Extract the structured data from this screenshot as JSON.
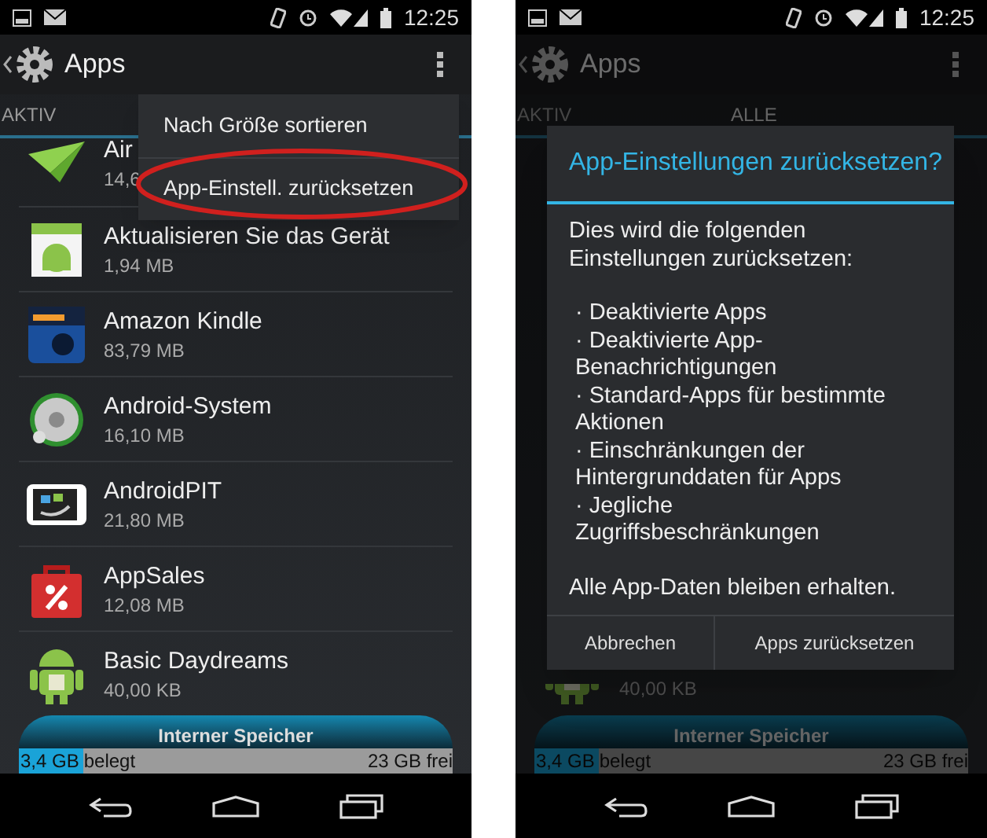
{
  "screens": [
    {
      "status_bar": {
        "time": "12:25"
      },
      "action_bar": {
        "title": "Apps"
      },
      "tabs": [
        {
          "label": "AKTIV",
          "selected": false
        }
      ],
      "apps": [
        {
          "name": "Air",
          "size": "14,6"
        },
        {
          "name": "Aktualisieren Sie das Gerät",
          "size": "1,94 MB"
        },
        {
          "name": "Amazon Kindle",
          "size": "83,79 MB"
        },
        {
          "name": "Android-System",
          "size": "16,10 MB"
        },
        {
          "name": "AndroidPIT",
          "size": "21,80 MB"
        },
        {
          "name": "AppSales",
          "size": "12,08 MB"
        },
        {
          "name": "Basic Daydreams",
          "size": "40,00 KB"
        }
      ],
      "storage": {
        "title": "Interner Speicher",
        "used_amount": "3,4 GB",
        "used_label": "belegt",
        "free": "23 GB frei",
        "level": 0.15
      },
      "menu": {
        "items": [
          {
            "label": "Nach Größe sortieren",
            "circled": false
          },
          {
            "label": "App-Einstell. zurücksetzen",
            "circled": true
          }
        ]
      }
    },
    {
      "status_bar": {
        "time": "12:25"
      },
      "action_bar": {
        "title": "Apps"
      },
      "tabs": [
        {
          "label": "AKTIV",
          "selected": false
        },
        {
          "label": "ALLE",
          "selected": true
        }
      ],
      "apps": [
        {
          "size": "40,00 KB"
        }
      ],
      "storage": {
        "title": "Interner Speicher",
        "used_amount": "3,4 GB",
        "used_label": "belegt",
        "free": "23 GB frei",
        "level": 0.15
      },
      "dialog": {
        "title": "App-Einstellungen zurücksetzen?",
        "intro": "Dies wird die folgenden Einstellungen zurücksetzen:",
        "bullets": [
          "· Deaktivierte Apps",
          "· Deaktivierte App-Benachrichtigungen",
          "· Standard-Apps für bestimmte Aktionen",
          "· Einschränkungen der Hintergrunddaten für Apps",
          "· Jegliche Zugriffsbeschränkungen"
        ],
        "footer": "Alle App-Daten bleiben erhalten.",
        "buttons": [
          "Abbrechen",
          "Apps zurücksetzen"
        ]
      }
    }
  ]
}
